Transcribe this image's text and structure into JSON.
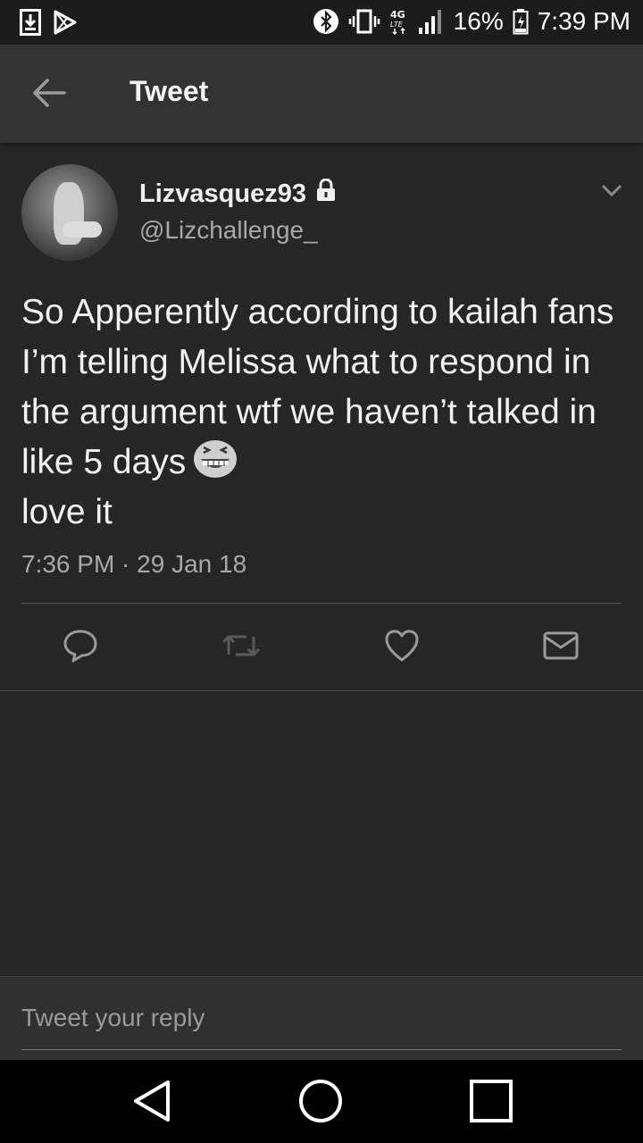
{
  "status_bar": {
    "battery_percent": "16%",
    "time": "7:39 PM",
    "network_label": "4G LTE",
    "icons": [
      "download-icon",
      "play-store-icon",
      "bluetooth-icon",
      "vibrate-icon",
      "lte-icon",
      "signal-icon",
      "battery-icon"
    ]
  },
  "app_bar": {
    "title": "Tweet"
  },
  "tweet": {
    "display_name": "Lizvasquez93",
    "handle": "@Lizchallenge_",
    "text_before_emoji": "So Apperently according to kailah fans I’m telling Melissa what to respond in the argument wtf we haven’t talked in like 5 days",
    "text_after_emoji": "love it",
    "timestamp": "7:36 PM · 29 Jan 18"
  },
  "reply": {
    "placeholder": "Tweet your reply"
  },
  "colors": {
    "background": "#262626",
    "app_bar": "#333333",
    "secondary_text": "#a8a8a8",
    "icon": "#9a9a9a"
  }
}
